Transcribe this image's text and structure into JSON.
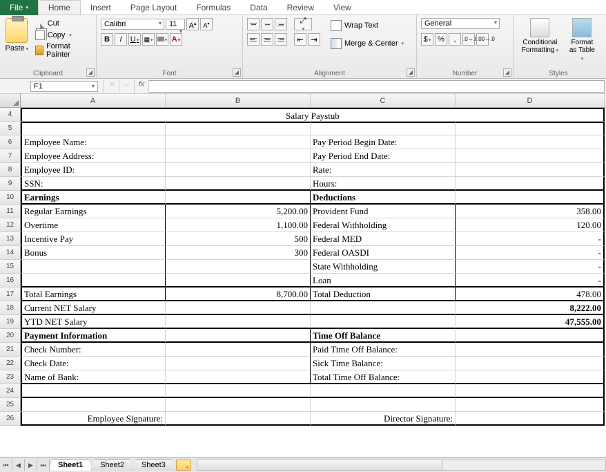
{
  "tabs": {
    "file": "File",
    "home": "Home",
    "insert": "Insert",
    "pageLayout": "Page Layout",
    "formulas": "Formulas",
    "data": "Data",
    "review": "Review",
    "view": "View"
  },
  "clipboard": {
    "paste": "Paste",
    "cut": "Cut",
    "copy": "Copy",
    "formatPainter": "Format Painter",
    "title": "Clipboard"
  },
  "font": {
    "name": "Calibri",
    "size": "11",
    "title": "Font"
  },
  "alignment": {
    "wrap": "Wrap Text",
    "merge": "Merge & Center",
    "title": "Alignment"
  },
  "number": {
    "format": "General",
    "title": "Number"
  },
  "styles": {
    "cond": "Conditional Formatting",
    "fmt": "Format as Table",
    "title": "Styles"
  },
  "namebox": "F1",
  "cols": {
    "A": "A",
    "B": "B",
    "C": "C",
    "D": "D"
  },
  "rows": [
    "4",
    "5",
    "6",
    "7",
    "8",
    "9",
    "10",
    "11",
    "12",
    "13",
    "14",
    "15",
    "16",
    "17",
    "18",
    "19",
    "20",
    "21",
    "22",
    "23",
    "24",
    "25",
    "26"
  ],
  "doc": {
    "title": "Salary Paystub",
    "empName": "Employee Name:",
    "empAddr": "Employee Address:",
    "empId": "Employee ID:",
    "ssn": "SSN:",
    "ppBegin": "Pay Period Begin Date:",
    "ppEnd": "Pay Period End Date:",
    "rate": "Rate:",
    "hours": "Hours:",
    "earnHdr": "Earnings",
    "dedHdr": "Deductions",
    "regEarn": "Regular Earnings",
    "regEarnV": "5,200.00",
    "overtime": "Overtime",
    "overtimeV": "1,100.00",
    "incent": "Incentive Pay",
    "incentV": "500",
    "bonus": "Bonus",
    "bonusV": "300",
    "prov": "Provident Fund",
    "provV": "358.00",
    "fedW": "Federal Withholding",
    "fedWV": "120.00",
    "fedM": "Federal MED",
    "fedMV": "-",
    "fedO": "Federal OASDI",
    "fedOV": "-",
    "stateW": "State Withholding",
    "stateWV": "-",
    "loan": "Loan",
    "loanV": "-",
    "totE": "Total Earnings",
    "totEV": "8,700.00",
    "totD": "Total Deduction",
    "totDV": "478.00",
    "curNet": "Current NET Salary",
    "curNetV": "8,222.00",
    "ytdNet": "YTD NET Salary",
    "ytdNetV": "47,555.00",
    "payInfo": "Payment Information",
    "timeOff": "Time Off Balance",
    "chkNum": "Check  Number:",
    "chkDate": "Check Date:",
    "bank": "Name of Bank:",
    "pto": "Paid Time Off Balance:",
    "sick": "Sick Time Balance:",
    "totTime": "Total Time Off Balance:",
    "empSig": "Employee Signature:",
    "dirSig": "Director  Signature:"
  },
  "sheets": {
    "s1": "Sheet1",
    "s2": "Sheet2",
    "s3": "Sheet3"
  }
}
